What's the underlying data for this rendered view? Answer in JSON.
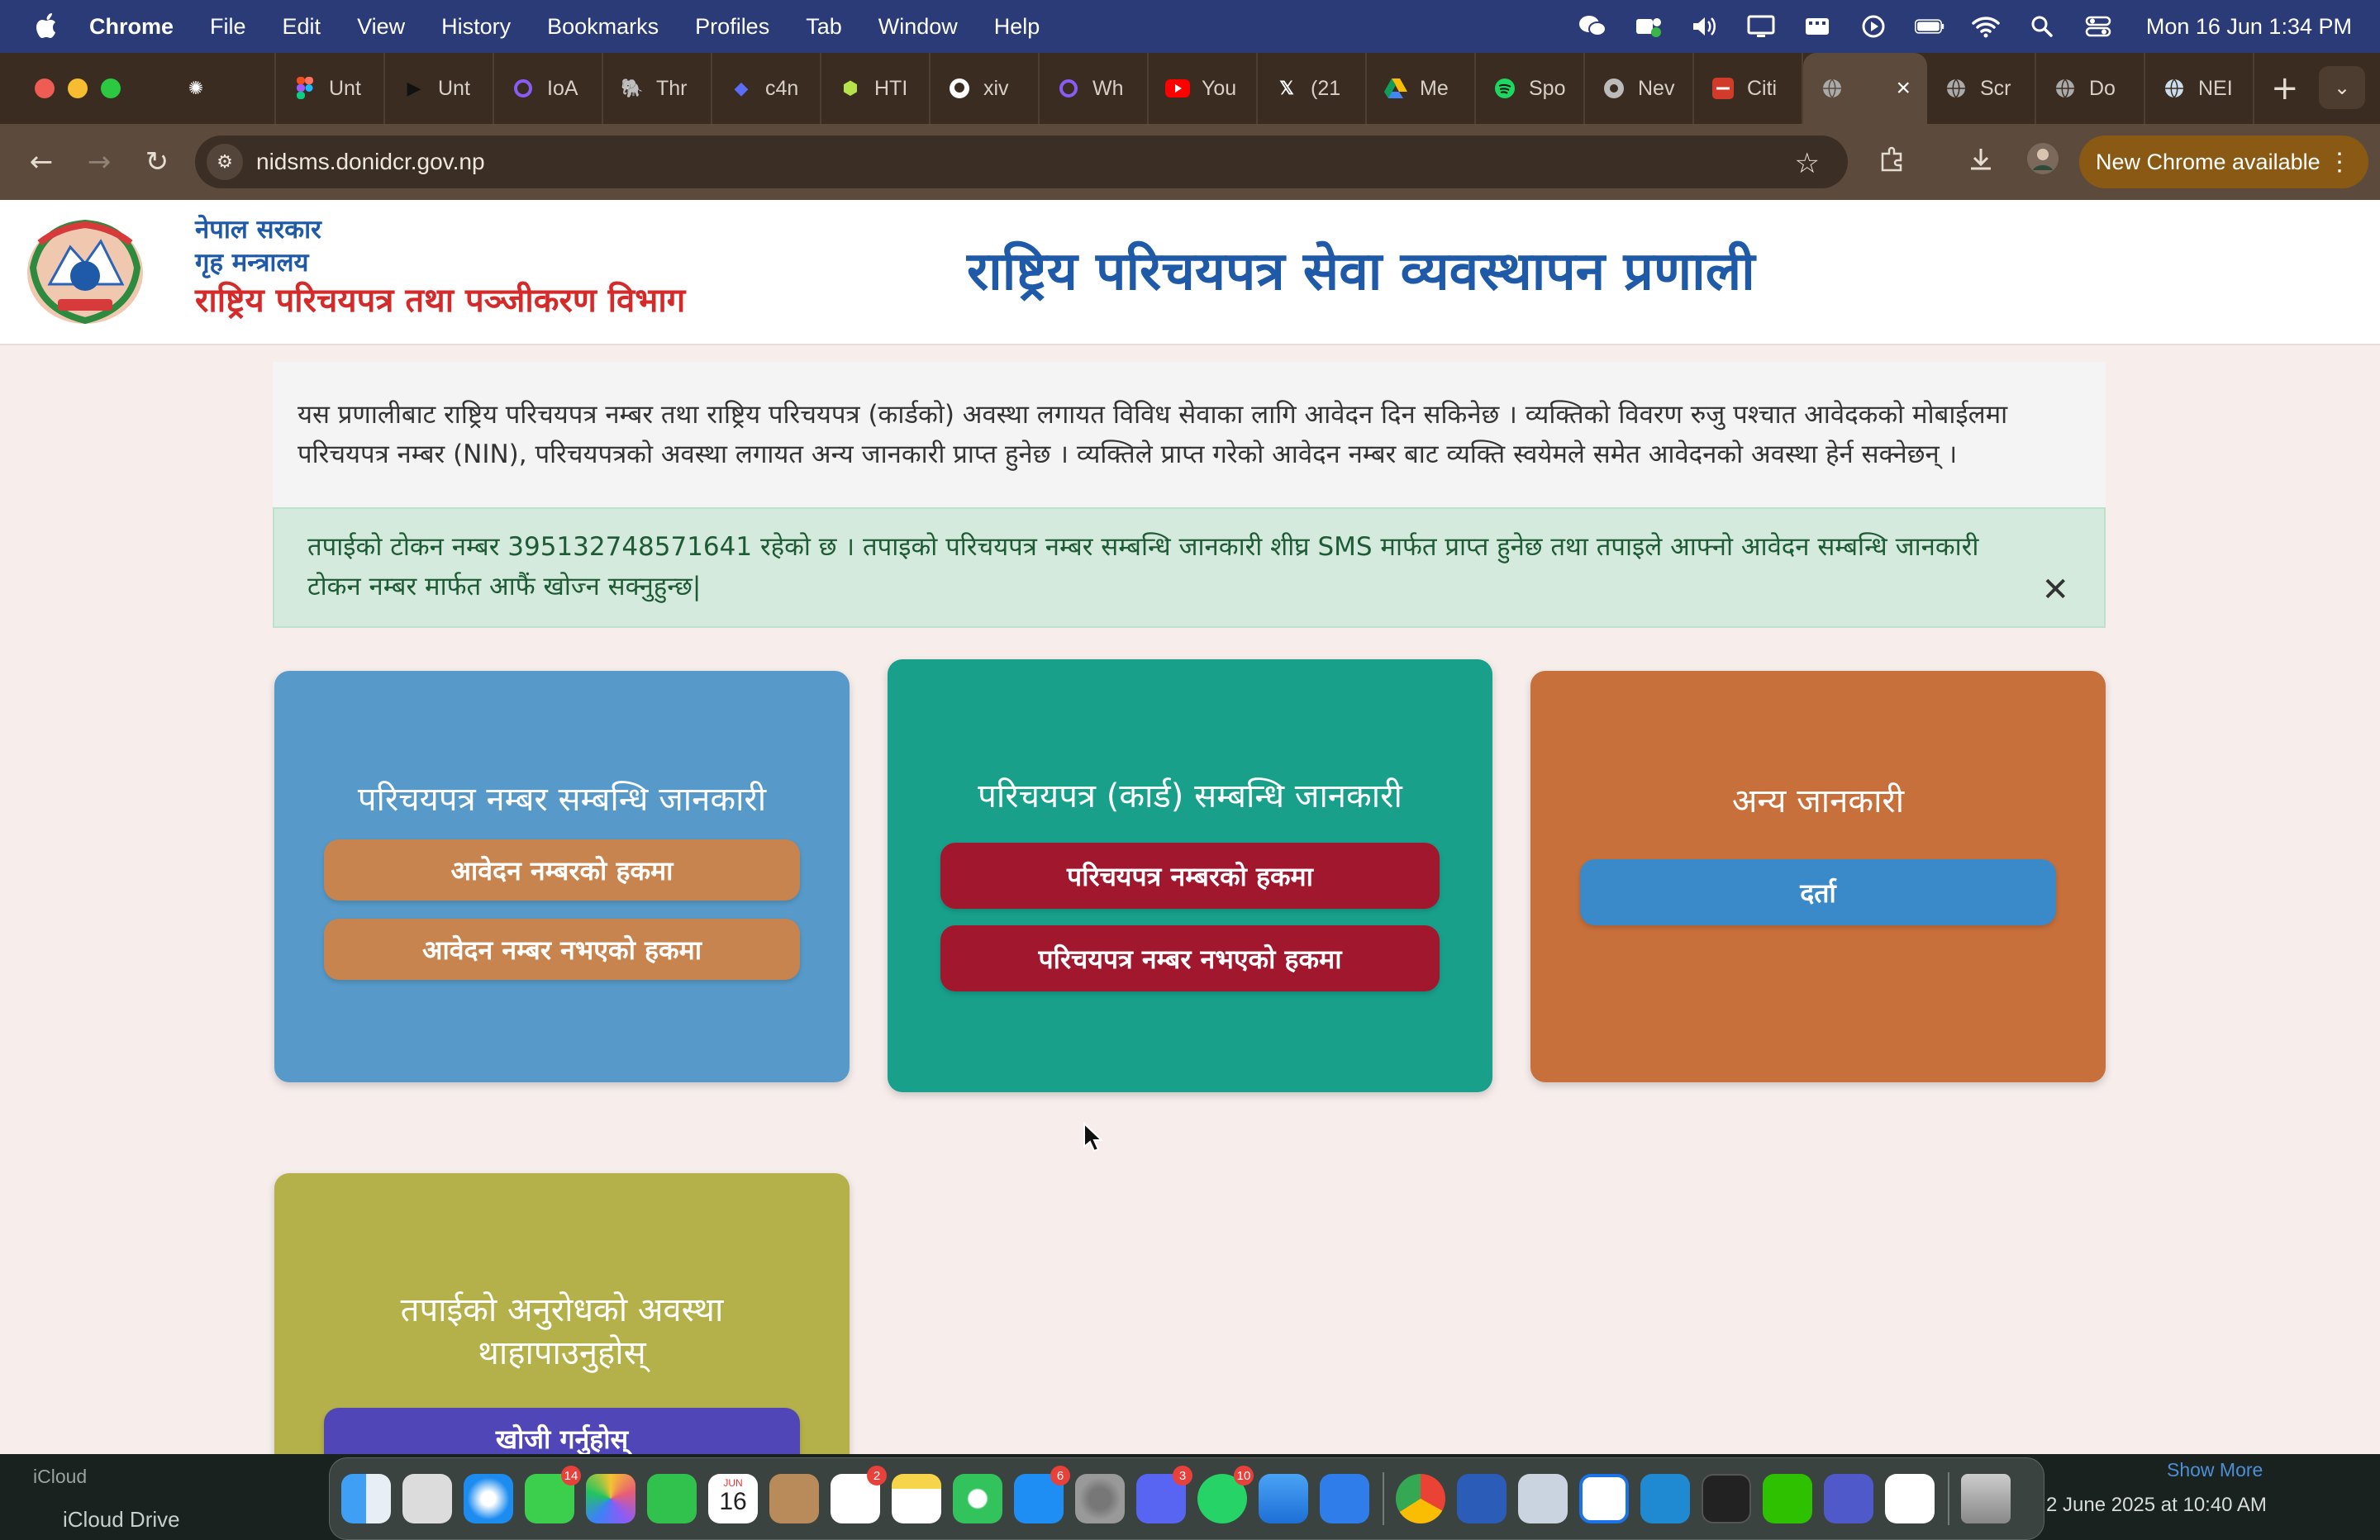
{
  "menubar": {
    "app_name": "Chrome",
    "menus": [
      "File",
      "Edit",
      "View",
      "History",
      "Bookmarks",
      "Profiles",
      "Tab",
      "Window",
      "Help"
    ],
    "clock": "Mon 16 Jun  1:34 PM"
  },
  "tabs": [
    {
      "label": "",
      "icon": "openai-icon"
    },
    {
      "label": "Unt",
      "icon": "figma-icon"
    },
    {
      "label": "Unt",
      "icon": "play-icon"
    },
    {
      "label": "IoA",
      "icon": "circle-icon"
    },
    {
      "label": "Thr",
      "icon": "elephant-icon"
    },
    {
      "label": "c4n",
      "icon": "cat-icon"
    },
    {
      "label": "HTI",
      "icon": "cube-icon"
    },
    {
      "label": "xiv",
      "icon": "github-icon"
    },
    {
      "label": "Wh",
      "icon": "circle-icon"
    },
    {
      "label": "You",
      "icon": "youtube-icon"
    },
    {
      "label": "(21",
      "icon": "x-icon"
    },
    {
      "label": "Me",
      "icon": "drive-icon"
    },
    {
      "label": "Spo",
      "icon": "spotify-icon"
    },
    {
      "label": "Nev",
      "icon": "chrome-icon"
    },
    {
      "label": "Citi",
      "icon": "citi-icon"
    },
    {
      "label": "",
      "icon": "globe-icon",
      "active": true
    },
    {
      "label": "Scr",
      "icon": "globe-icon"
    },
    {
      "label": "Do",
      "icon": "globe-icon"
    },
    {
      "label": "NEI",
      "icon": "globe-icon"
    }
  ],
  "toolbar": {
    "url": "nidsms.donidcr.gov.np",
    "update_label": "New Chrome available"
  },
  "header": {
    "line1": "नेपाल सरकार",
    "line2": "गृह मन्त्रालय",
    "line3": "राष्ट्रिय परिचयपत्र तथा पञ्जीकरण विभाग",
    "system_title": "राष्ट्रिय परिचयपत्र सेवा व्यवस्थापन प्रणाली"
  },
  "intro_text": "यस प्रणालीबाट राष्ट्रिय परिचयपत्र नम्बर तथा राष्ट्रिय परिचयपत्र (कार्डको) अवस्था लगायत विविध सेवाका लागि आवेदन दिन सकिनेछ । व्यक्तिको विवरण रुजु पश्चात आवेदकको मोबाईलमा परिचयपत्र नम्बर (NIN), परिचयपत्रको अवस्था लगायत अन्य जानकारी प्राप्त हुनेछ । व्यक्तिले प्राप्त गरेको आवेदन नम्बर बाट व्यक्ति स्वयेमले समेत आवेदनको अवस्था हेर्न सक्नेछन् ।",
  "alert": {
    "text": "तपाईको टोकन नम्बर 395132748571641 रहेको छ । तपाइको परिचयपत्र नम्बर सम्बन्धि जानकारी शीघ्र SMS मार्फत प्राप्त हुनेछ तथा तपाइले आफ्नो आवेदन सम्बन्धि जानकारी टोकन नम्बर मार्फत आफैं खोज्न सक्नुहुन्छ|",
    "close": "✕"
  },
  "cards": {
    "nin": {
      "title": "परिचयपत्र नम्बर सम्बन्धि जानकारी",
      "btn1": "आवेदन नम्बरको हकमा",
      "btn2": "आवेदन नम्बर नभएको हकमा",
      "color": "#579ac9"
    },
    "card": {
      "title": "परिचयपत्र (कार्ड) सम्बन्धि जानकारी",
      "btn1": "परिचयपत्र नम्बरको हकमा",
      "btn2": "परिचयपत्र नम्बर नभएको हकमा",
      "color": "#18a08b"
    },
    "other": {
      "title": "अन्य जानकारी",
      "btn1": "दर्ता",
      "color": "#c7703b"
    },
    "status": {
      "title_line1": "तपाईको अनुरोधको अवस्था",
      "title_line2": "थाहापाउनुहोस्",
      "btn1": "खोजी गर्नुहोस्",
      "color": "#b4b04a"
    }
  },
  "desktop": {
    "sidebar_heading": "iCloud",
    "sidebar_item": "iCloud Drive",
    "show_more": "Show More",
    "date_text": "2 June 2025 at 10:40 AM"
  },
  "dock": {
    "badges": {
      "messages": "14",
      "reminders": "2",
      "appstore": "6",
      "discord": "3",
      "whatsapp": "10"
    },
    "calendar_month": "JUN",
    "calendar_day": "16"
  },
  "colors": {
    "menubar": "#2a3b78",
    "tabstrip": "#3a2c20",
    "toolbar": "#5c4b3c",
    "header_blue": "#1e5aa8",
    "header_red": "#d42a2a",
    "alert_bg": "#d3eadc"
  }
}
